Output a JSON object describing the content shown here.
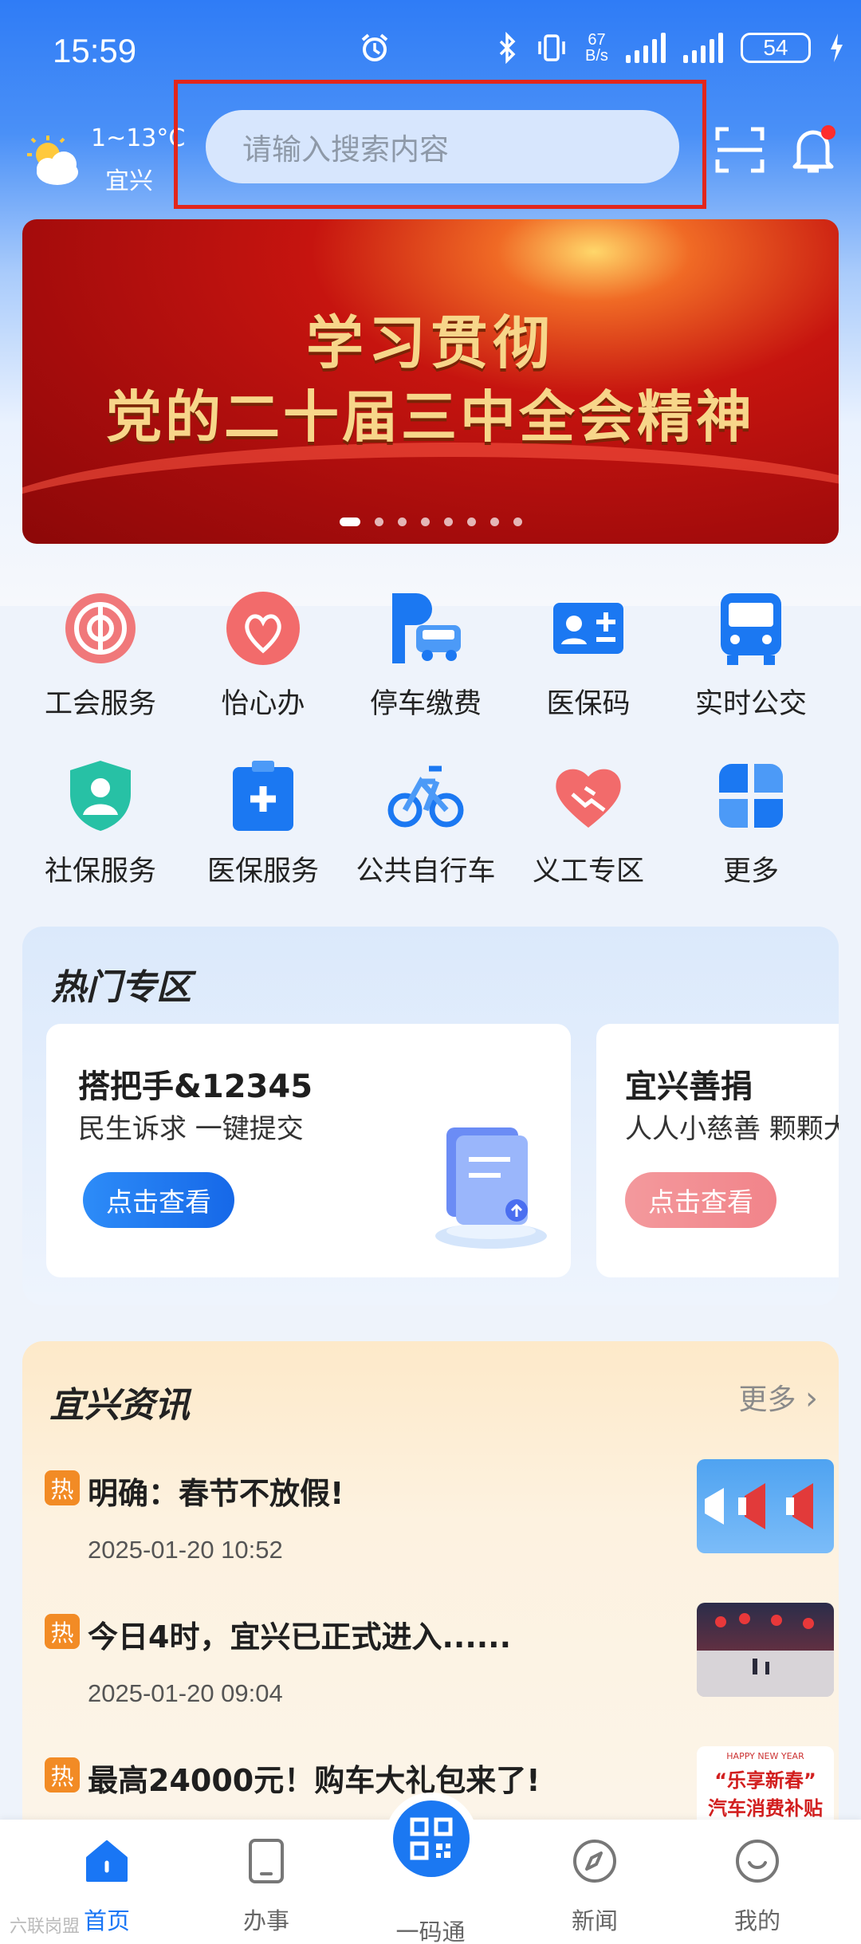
{
  "status": {
    "time": "15:59",
    "net_speed_value": "67",
    "net_speed_unit": "B/s",
    "battery": "54"
  },
  "header": {
    "temp": "1~13°C",
    "city": "宜兴",
    "search_placeholder": "请输入搜索内容"
  },
  "banner": {
    "line1": "学习贯彻",
    "line2": "党的二十届三中全会精神"
  },
  "services": [
    {
      "label": "工会服务",
      "icon": "union-icon"
    },
    {
      "label": "怡心办",
      "icon": "heart-icon"
    },
    {
      "label": "停车缴费",
      "icon": "parking-icon"
    },
    {
      "label": "医保码",
      "icon": "medical-card-icon"
    },
    {
      "label": "实时公交",
      "icon": "bus-icon"
    },
    {
      "label": "社保服务",
      "icon": "shield-user-icon"
    },
    {
      "label": "医保服务",
      "icon": "medical-kit-icon"
    },
    {
      "label": "公共自行车",
      "icon": "bicycle-icon"
    },
    {
      "label": "义工专区",
      "icon": "handshake-icon"
    },
    {
      "label": "更多",
      "icon": "grid-more-icon"
    }
  ],
  "hot": {
    "title": "热门专区",
    "cards": [
      {
        "title": "搭把手&12345",
        "subtitle": "民生诉求 一键提交",
        "button": "点击查看",
        "color": "#1a7af4"
      },
      {
        "title": "宜兴善捐",
        "subtitle": "人人小慈善 颗颗大",
        "button": "点击查看",
        "color": "#f26b72"
      }
    ]
  },
  "news": {
    "title": "宜兴资讯",
    "more": "更多",
    "tag": "热",
    "items": [
      {
        "title": "明确：春节不放假!",
        "date": "2025-01-20 10:52"
      },
      {
        "title": "今日4时，宜兴已正式进入......",
        "date": "2025-01-20 09:04"
      },
      {
        "title": "最高24000元！购车大礼包来了!",
        "date": ""
      }
    ],
    "thumb3_top": "HAPPY NEW YEAR",
    "thumb3_main": "“乐享新春”",
    "thumb3_sub": "汽车消费补贴"
  },
  "tabbar": [
    {
      "label": "首页",
      "icon": "home-icon",
      "active": true
    },
    {
      "label": "办事",
      "icon": "tablet-icon",
      "active": false
    },
    {
      "label": "一码通",
      "icon": "qr-code-icon",
      "active": false
    },
    {
      "label": "新闻",
      "icon": "compass-icon",
      "active": false
    },
    {
      "label": "我的",
      "icon": "smile-icon",
      "active": false
    }
  ],
  "watermark": "六联岗盟"
}
